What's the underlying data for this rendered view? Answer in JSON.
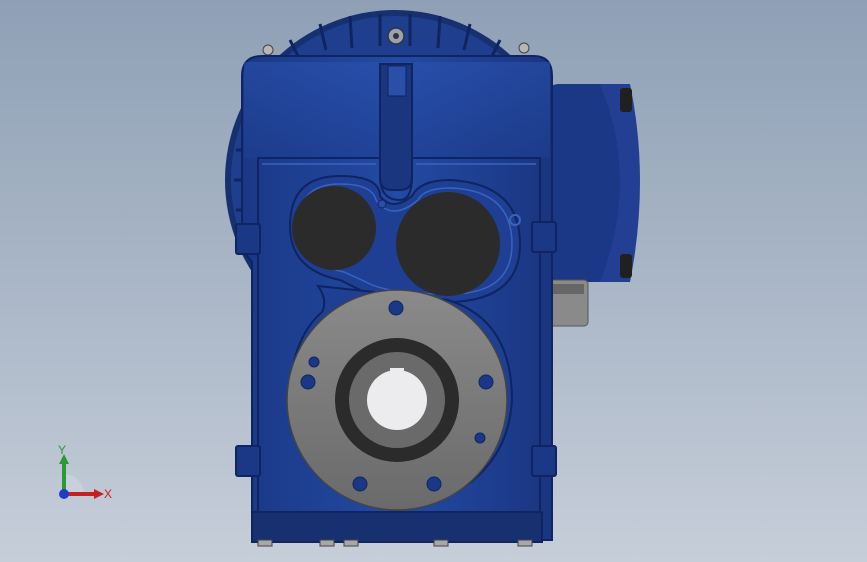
{
  "triad": {
    "x_label": "X",
    "y_label": "Y"
  },
  "colors": {
    "background_top": "#8fa0b6",
    "background_bottom": "#c6ced9",
    "housing_blue": "#1d3d8f",
    "housing_dark": "#0f2460",
    "flange_gray": "#777777",
    "hole_dark": "#2b2b2b",
    "axis_x": "#c81e1e",
    "axis_y": "#2a9a32",
    "axis_z": "#1e3cc8"
  }
}
